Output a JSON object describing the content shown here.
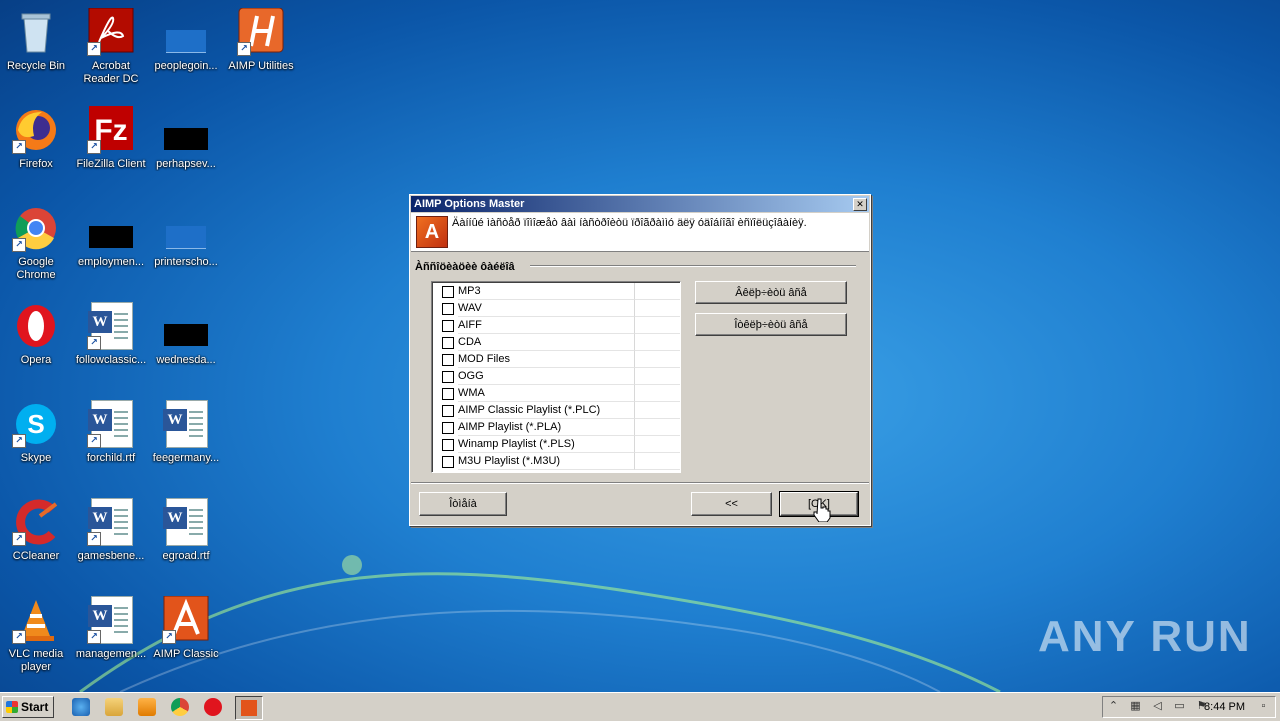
{
  "desktop": {
    "icons": [
      {
        "label": "Recycle Bin"
      },
      {
        "label": "Acrobat Reader DC"
      },
      {
        "label": "peoplegoin..."
      },
      {
        "label": "AIMP Utilities"
      },
      {
        "label": "Firefox"
      },
      {
        "label": "FileZilla Client"
      },
      {
        "label": "perhapsev..."
      },
      {
        "label": "Google Chrome"
      },
      {
        "label": "employmen..."
      },
      {
        "label": "printerscho..."
      },
      {
        "label": "Opera"
      },
      {
        "label": "followclassic..."
      },
      {
        "label": "wednesda..."
      },
      {
        "label": "Skype"
      },
      {
        "label": "forchild.rtf"
      },
      {
        "label": "feegermany..."
      },
      {
        "label": "CCleaner"
      },
      {
        "label": "gamesbene..."
      },
      {
        "label": "egroad.rtf"
      },
      {
        "label": "VLC media player"
      },
      {
        "label": "managemen..."
      },
      {
        "label": "AIMP Classic"
      }
    ]
  },
  "dialog": {
    "title": "AIMP Options Master",
    "close_glyph": "✕",
    "header_logo": "A",
    "header_text": "Äàííûé ìàñòåð ïîìîæåò âàì íàñòðîèòü ïðîãðàììó äëÿ óäîáíîãî èñïîëüçîâàíèÿ.",
    "section_label": "Àññîöèàöèè ôàéëîâ",
    "file_types": [
      "MP3",
      "WAV",
      "AIFF",
      "CDA",
      "MOD Files",
      "OGG",
      "WMA",
      "AIMP Classic Playlist (*.PLC)",
      "AIMP Playlist (*.PLA)",
      "Winamp Playlist (*.PLS)",
      "M3U Playlist (*.M3U)"
    ],
    "select_all_label": "Âêëþ÷èòü âñå",
    "deselect_all_label": "Îòêëþ÷èòü âñå",
    "cancel_label": "Îòìåíà",
    "back_label": "<<",
    "ok_label": "[OK]"
  },
  "taskbar": {
    "start_label": "Start",
    "clock": "8:44 PM"
  },
  "watermark": "ANY RUN"
}
